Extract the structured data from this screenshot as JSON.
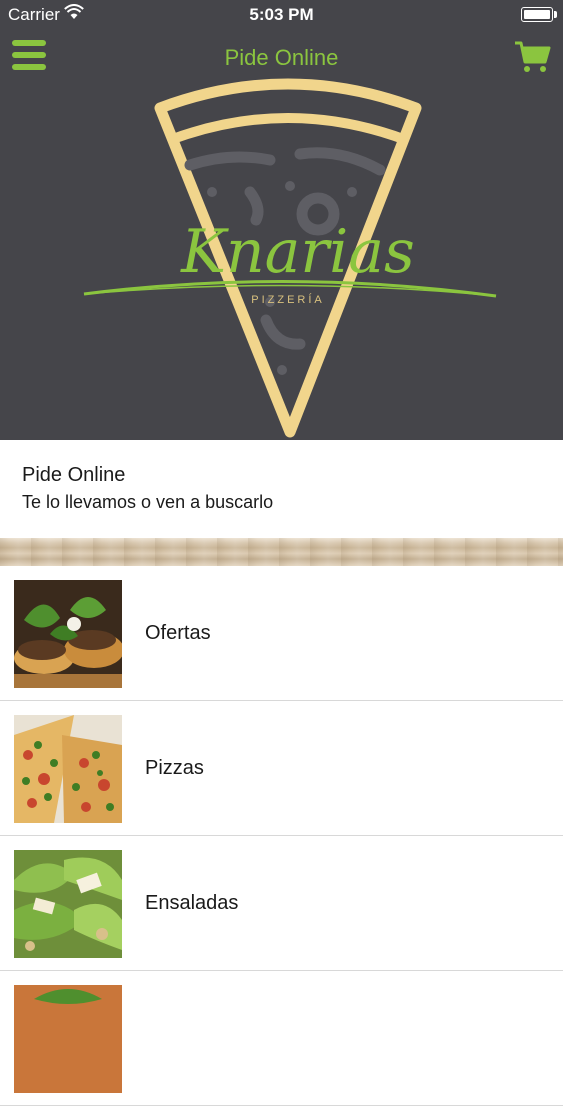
{
  "status_bar": {
    "carrier": "Carrier",
    "time": "5:03 PM"
  },
  "navbar": {
    "title": "Pide Online",
    "accent": "#8bc53f"
  },
  "logo": {
    "brand": "Knarias",
    "subtitle": "PIZZERÍA"
  },
  "info": {
    "title": "Pide Online",
    "subtitle": "Te lo llevamos o ven a buscarlo"
  },
  "menu": {
    "items": [
      {
        "label": "Ofertas"
      },
      {
        "label": "Pizzas"
      },
      {
        "label": "Ensaladas"
      }
    ]
  }
}
